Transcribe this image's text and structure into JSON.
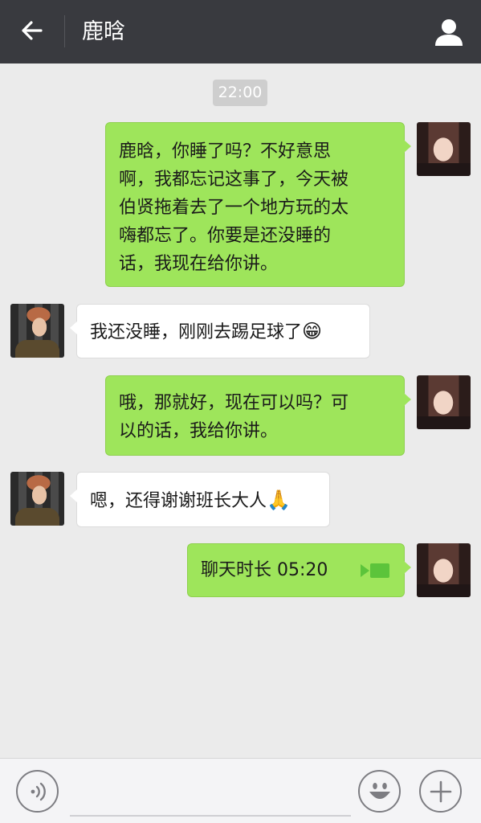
{
  "header": {
    "title": "鹿晗",
    "back_icon": "arrow-left-icon",
    "profile_icon": "person-icon"
  },
  "timestamp": "22:00",
  "messages": [
    {
      "direction": "out",
      "lines": [
        "鹿晗，你睡了吗？不好意思",
        "啊，我都忘记这事了，今天被",
        "伯贤拖着去了一个地方玩的太",
        "嗨都忘了。你要是还没睡的",
        "话，我现在给你讲。"
      ]
    },
    {
      "direction": "in",
      "text": "我还没睡，刚刚去踢足球了",
      "emoji": "😁"
    },
    {
      "direction": "out",
      "lines": [
        "哦，那就好，现在可以吗？可",
        "以的话，我给你讲。"
      ]
    },
    {
      "direction": "in",
      "text": "嗯，还得谢谢班长大人",
      "emoji": "🙏"
    },
    {
      "direction": "out",
      "call_text": "聊天时长 05:20",
      "icon": "video-call-icon"
    }
  ],
  "input": {
    "placeholder": ""
  },
  "toolbar": {
    "voice_icon": "voice-icon",
    "emoji_icon": "emoji-icon",
    "plus_icon": "plus-icon"
  },
  "colors": {
    "header_bg": "#393a3f",
    "chat_bg": "#ebebeb",
    "out_bubble": "#9ee55b",
    "in_bubble": "#ffffff"
  }
}
